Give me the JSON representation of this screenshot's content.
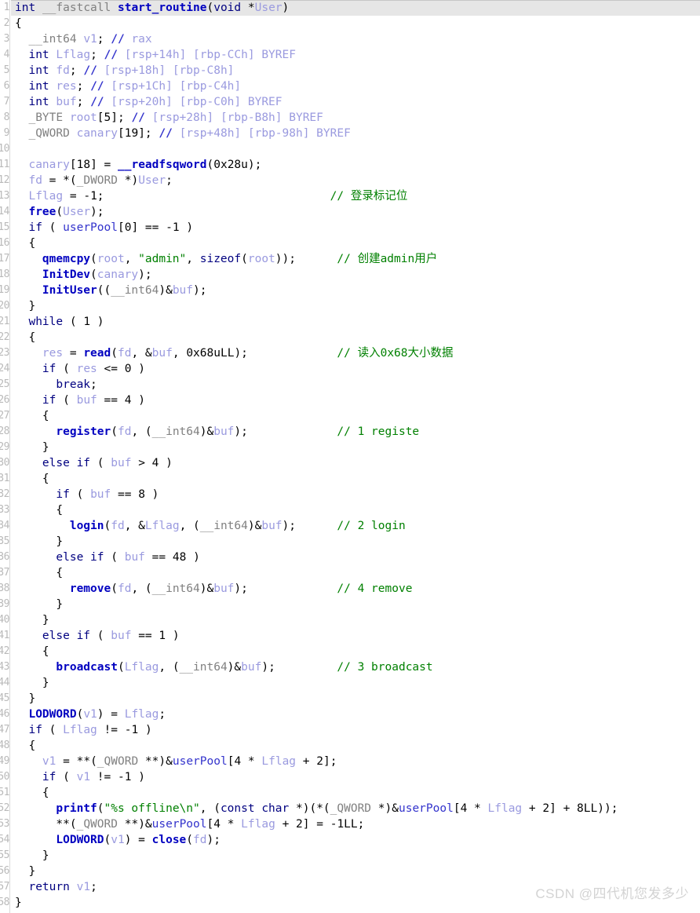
{
  "view": {
    "name": "ida-pseudocode-view",
    "function_signature": "int __fastcall start_routine(void *User)",
    "current_line_index": 1,
    "background_color": "#ffffff",
    "current_line_color": "#e6e6e6"
  },
  "colors": {
    "keyword": "#000080",
    "highlighted_identifier": "#00008B",
    "type": "#808080",
    "function": "#0000C0",
    "local_variable": "#9A9ADF",
    "global_variable": "#3333CC",
    "string": "#008000",
    "comment": "#008000",
    "declaration_comment": "#9A9ADF",
    "line_number": "#b9b9b9",
    "watermark": "#d3d3d3"
  },
  "gutter": {
    "line_numbers": [
      "1",
      "2",
      "3",
      "4",
      "5",
      "6",
      "7",
      "8",
      "9",
      "10",
      "11",
      "12",
      "13",
      "14",
      "15",
      "16",
      "17",
      "18",
      "19",
      "20",
      "21",
      "22",
      "23",
      "24",
      "25",
      "26",
      "27",
      "28",
      "29",
      "30",
      "31",
      "32",
      "33",
      "34",
      "35",
      "36",
      "37",
      "38",
      "39",
      "40",
      "41",
      "42",
      "43",
      "44",
      "45",
      "46",
      "47",
      "48",
      "49",
      "50",
      "51",
      "52",
      "53",
      "54",
      "55",
      "56",
      "57",
      "58"
    ]
  },
  "code_lines": [
    "int __fastcall start_routine(void *User)",
    "{",
    "  __int64 v1; // rax",
    "  int Lflag; // [rsp+14h] [rbp-CCh] BYREF",
    "  int fd; // [rsp+18h] [rbp-C8h]",
    "  int res; // [rsp+1Ch] [rbp-C4h]",
    "  int buf; // [rsp+20h] [rbp-C0h] BYREF",
    "  _BYTE root[5]; // [rsp+28h] [rbp-B8h] BYREF",
    "  _QWORD canary[19]; // [rsp+48h] [rbp-98h] BYREF",
    "",
    "  canary[18] = __readfsqword(0x28u);",
    "  fd = *(_DWORD *)User;",
    "  Lflag = -1;                                 // 登录标记位",
    "  free(User);",
    "  if ( userPool[0] == -1 )",
    "  {",
    "    qmemcpy(root, \"admin\", sizeof(root));      // 创建admin用户",
    "    InitDev(canary);",
    "    InitUser((__int64)&buf);",
    "  }",
    "  while ( 1 )",
    "  {",
    "    res = read(fd, &buf, 0x68uLL);             // 读入0x68大小数据",
    "    if ( res <= 0 )",
    "      break;",
    "    if ( buf == 4 )",
    "    {",
    "      register(fd, (__int64)&buf);             // 1 registe",
    "    }",
    "    else if ( buf > 4 )",
    "    {",
    "      if ( buf == 8 )",
    "      {",
    "        login(fd, &Lflag, (__int64)&buf);      // 2 login",
    "      }",
    "      else if ( buf == 48 )",
    "      {",
    "        remove(fd, (__int64)&buf);             // 4 remove",
    "      }",
    "    }",
    "    else if ( buf == 1 )",
    "    {",
    "      broadcast(Lflag, (__int64)&buf);         // 3 broadcast",
    "    }",
    "  }",
    "  LODWORD(v1) = Lflag;",
    "  if ( Lflag != -1 )",
    "  {",
    "    v1 = **(_QWORD **)&userPool[4 * Lflag + 2];",
    "    if ( v1 != -1 )",
    "    {",
    "      printf(\"%s offline\\n\", (const char *)(*(_QWORD *)&userPool[4 * Lflag + 2] + 8LL));",
    "      **(_QWORD **)&userPool[4 * Lflag + 2] = -1LL;",
    "      LODWORD(v1) = close(fd);",
    "    }",
    "  }",
    "  return v1;",
    "}"
  ],
  "comments": [
    "// 登录标记位",
    "// 创建admin用户",
    "// 读入0x68大小数据",
    "// 1 registe",
    "// 2 login",
    "// 4 remove",
    "// 3 broadcast"
  ],
  "declaration_comments": [
    "// rax",
    "// [rsp+14h] [rbp-CCh] BYREF",
    "// [rsp+18h] [rbp-C8h]",
    "// [rsp+1Ch] [rbp-C4h]",
    "// [rsp+20h] [rbp-C0h] BYREF",
    "// [rsp+28h] [rbp-B8h] BYREF",
    "// [rsp+48h] [rbp-98h] BYREF"
  ],
  "string_literals": [
    "\"admin\"",
    "\"%s offline\\n\""
  ],
  "functions_called": [
    "__readfsqword",
    "free",
    "qmemcpy",
    "sizeof",
    "InitDev",
    "InitUser",
    "read",
    "register",
    "login",
    "remove",
    "broadcast",
    "LODWORD",
    "printf",
    "close"
  ],
  "local_variables": [
    "v1",
    "Lflag",
    "fd",
    "res",
    "buf",
    "root",
    "canary",
    "User"
  ],
  "global_variables": [
    "userPool"
  ],
  "watermark": {
    "text": "CSDN @四代机您发多少"
  }
}
